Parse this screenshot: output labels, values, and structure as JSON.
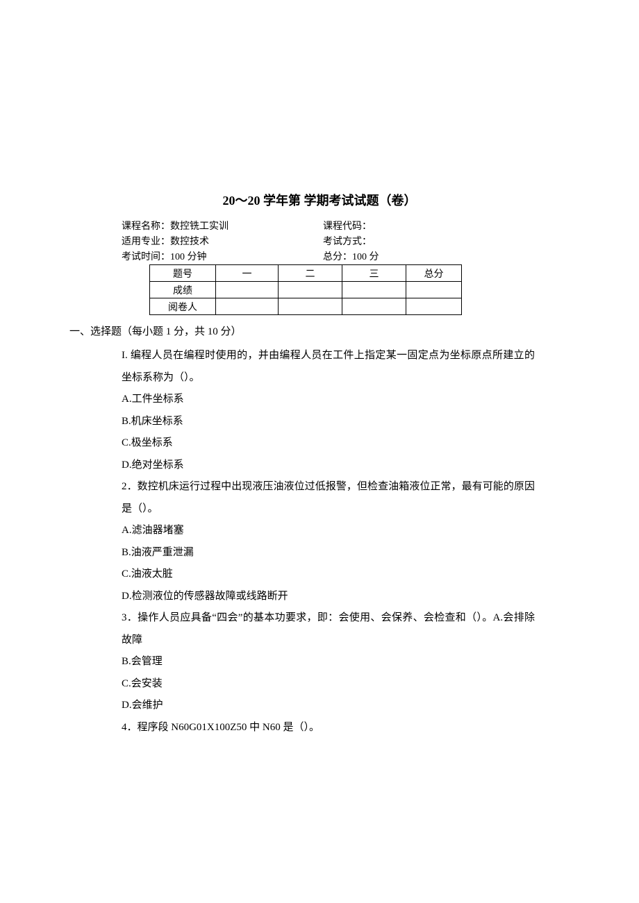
{
  "title": "20～20 学年第 学期考试试题（卷）",
  "meta": {
    "course_name_label": "课程名称：",
    "course_name_value": "数控铣工实训",
    "course_code_label": "课程代码：",
    "major_label": "适用专业：",
    "major_value": "数控技术",
    "exam_mode_label": "考试方式：",
    "exam_time_label": "考试时间：",
    "exam_time_value": "100 分钟",
    "total_score_label": "总分：100 分"
  },
  "score_table": {
    "row1": [
      "题号",
      "一",
      "二",
      "三",
      "总分"
    ],
    "row2": [
      "成绩",
      "",
      "",
      "",
      ""
    ],
    "row3": [
      "阅卷人",
      "",
      "",
      "",
      ""
    ]
  },
  "section1_title": "一、选择题（每小题 1 分，共 10 分）",
  "q1": {
    "num": "I.",
    "text": " 编程人员在编程时使用的，并由编程人员在工件上指定某一固定点为坐标原点所建立的坐标系称为（）。",
    "a": "A.工件坐标系",
    "b": "B.机床坐标系",
    "c": "C.极坐标系",
    "d": "D.绝对坐标系"
  },
  "q2": {
    "num": "2",
    "text": "．数控机床运行过程中出现液压油液位过低报警，但检查油箱液位正常，最有可能的原因是（）。",
    "a": "A.滤油器堵塞",
    "b": "B.油液严重泄漏",
    "c": "C.油液太脏",
    "d": "D.检测液位的传感器故障或线路断开"
  },
  "q3": {
    "num": "3",
    "text": "．操作人员应具备“四会”的基本功要求，即：会使用、会保养、会检查和（）。A.会排除故障",
    "b": "B.会管理",
    "c": "C.会安装",
    "d": "D.会维护"
  },
  "q4": {
    "num": "4",
    "text": "．程序段 N60G01X100Z50 中 N60 是（）。"
  }
}
